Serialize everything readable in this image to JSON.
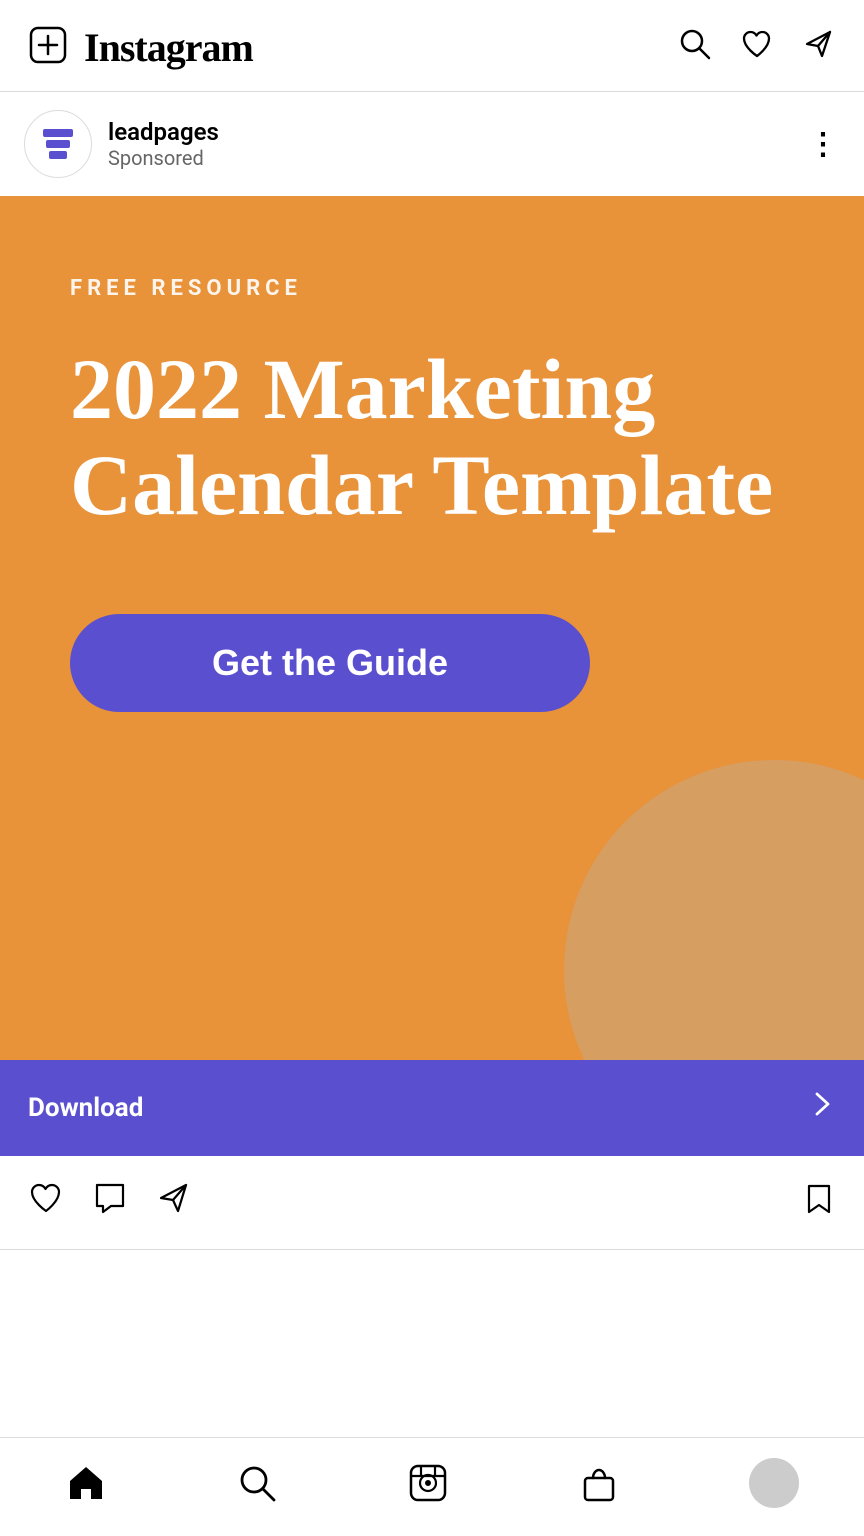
{
  "app": {
    "name": "Instagram"
  },
  "header": {
    "new_post_label": "⊕",
    "logo": "Instagram",
    "search_icon": "search",
    "heart_icon": "heart",
    "send_icon": "send"
  },
  "post": {
    "account_name": "leadpages",
    "sponsored_label": "Sponsored",
    "more_icon": "⋮"
  },
  "ad": {
    "free_resource_label": "FREE  RESOURCE",
    "title": "2022 Marketing Calendar Template",
    "cta_button": "Get the Guide",
    "accent_color": "#E8923A",
    "button_color": "#5a4fcf",
    "decorative_color": "#d4a06a"
  },
  "download_bar": {
    "label": "Download",
    "chevron": "›"
  },
  "actions": {
    "like_icon": "heart",
    "comment_icon": "comment",
    "share_icon": "send",
    "bookmark_icon": "bookmark"
  },
  "bottom_nav": {
    "home_icon": "home",
    "search_icon": "search",
    "reels_icon": "reels",
    "shop_icon": "shop",
    "profile_icon": "profile"
  }
}
